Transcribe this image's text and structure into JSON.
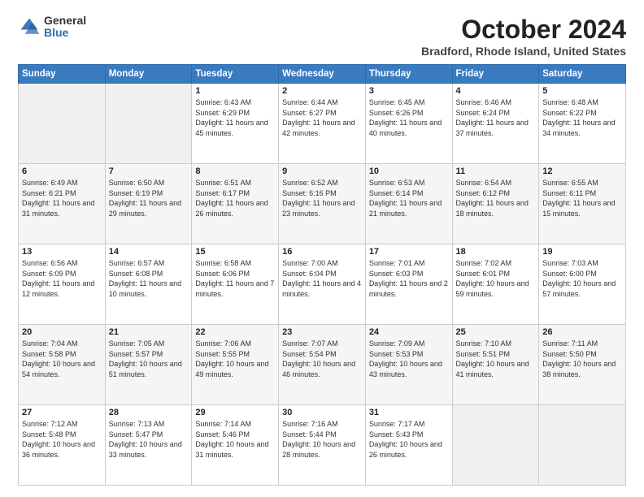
{
  "logo": {
    "general": "General",
    "blue": "Blue"
  },
  "title": "October 2024",
  "location": "Bradford, Rhode Island, United States",
  "days_of_week": [
    "Sunday",
    "Monday",
    "Tuesday",
    "Wednesday",
    "Thursday",
    "Friday",
    "Saturday"
  ],
  "weeks": [
    [
      {
        "day": "",
        "sunrise": "",
        "sunset": "",
        "daylight": ""
      },
      {
        "day": "",
        "sunrise": "",
        "sunset": "",
        "daylight": ""
      },
      {
        "day": "1",
        "sunrise": "Sunrise: 6:43 AM",
        "sunset": "Sunset: 6:29 PM",
        "daylight": "Daylight: 11 hours and 45 minutes."
      },
      {
        "day": "2",
        "sunrise": "Sunrise: 6:44 AM",
        "sunset": "Sunset: 6:27 PM",
        "daylight": "Daylight: 11 hours and 42 minutes."
      },
      {
        "day": "3",
        "sunrise": "Sunrise: 6:45 AM",
        "sunset": "Sunset: 6:26 PM",
        "daylight": "Daylight: 11 hours and 40 minutes."
      },
      {
        "day": "4",
        "sunrise": "Sunrise: 6:46 AM",
        "sunset": "Sunset: 6:24 PM",
        "daylight": "Daylight: 11 hours and 37 minutes."
      },
      {
        "day": "5",
        "sunrise": "Sunrise: 6:48 AM",
        "sunset": "Sunset: 6:22 PM",
        "daylight": "Daylight: 11 hours and 34 minutes."
      }
    ],
    [
      {
        "day": "6",
        "sunrise": "Sunrise: 6:49 AM",
        "sunset": "Sunset: 6:21 PM",
        "daylight": "Daylight: 11 hours and 31 minutes."
      },
      {
        "day": "7",
        "sunrise": "Sunrise: 6:50 AM",
        "sunset": "Sunset: 6:19 PM",
        "daylight": "Daylight: 11 hours and 29 minutes."
      },
      {
        "day": "8",
        "sunrise": "Sunrise: 6:51 AM",
        "sunset": "Sunset: 6:17 PM",
        "daylight": "Daylight: 11 hours and 26 minutes."
      },
      {
        "day": "9",
        "sunrise": "Sunrise: 6:52 AM",
        "sunset": "Sunset: 6:16 PM",
        "daylight": "Daylight: 11 hours and 23 minutes."
      },
      {
        "day": "10",
        "sunrise": "Sunrise: 6:53 AM",
        "sunset": "Sunset: 6:14 PM",
        "daylight": "Daylight: 11 hours and 21 minutes."
      },
      {
        "day": "11",
        "sunrise": "Sunrise: 6:54 AM",
        "sunset": "Sunset: 6:12 PM",
        "daylight": "Daylight: 11 hours and 18 minutes."
      },
      {
        "day": "12",
        "sunrise": "Sunrise: 6:55 AM",
        "sunset": "Sunset: 6:11 PM",
        "daylight": "Daylight: 11 hours and 15 minutes."
      }
    ],
    [
      {
        "day": "13",
        "sunrise": "Sunrise: 6:56 AM",
        "sunset": "Sunset: 6:09 PM",
        "daylight": "Daylight: 11 hours and 12 minutes."
      },
      {
        "day": "14",
        "sunrise": "Sunrise: 6:57 AM",
        "sunset": "Sunset: 6:08 PM",
        "daylight": "Daylight: 11 hours and 10 minutes."
      },
      {
        "day": "15",
        "sunrise": "Sunrise: 6:58 AM",
        "sunset": "Sunset: 6:06 PM",
        "daylight": "Daylight: 11 hours and 7 minutes."
      },
      {
        "day": "16",
        "sunrise": "Sunrise: 7:00 AM",
        "sunset": "Sunset: 6:04 PM",
        "daylight": "Daylight: 11 hours and 4 minutes."
      },
      {
        "day": "17",
        "sunrise": "Sunrise: 7:01 AM",
        "sunset": "Sunset: 6:03 PM",
        "daylight": "Daylight: 11 hours and 2 minutes."
      },
      {
        "day": "18",
        "sunrise": "Sunrise: 7:02 AM",
        "sunset": "Sunset: 6:01 PM",
        "daylight": "Daylight: 10 hours and 59 minutes."
      },
      {
        "day": "19",
        "sunrise": "Sunrise: 7:03 AM",
        "sunset": "Sunset: 6:00 PM",
        "daylight": "Daylight: 10 hours and 57 minutes."
      }
    ],
    [
      {
        "day": "20",
        "sunrise": "Sunrise: 7:04 AM",
        "sunset": "Sunset: 5:58 PM",
        "daylight": "Daylight: 10 hours and 54 minutes."
      },
      {
        "day": "21",
        "sunrise": "Sunrise: 7:05 AM",
        "sunset": "Sunset: 5:57 PM",
        "daylight": "Daylight: 10 hours and 51 minutes."
      },
      {
        "day": "22",
        "sunrise": "Sunrise: 7:06 AM",
        "sunset": "Sunset: 5:55 PM",
        "daylight": "Daylight: 10 hours and 49 minutes."
      },
      {
        "day": "23",
        "sunrise": "Sunrise: 7:07 AM",
        "sunset": "Sunset: 5:54 PM",
        "daylight": "Daylight: 10 hours and 46 minutes."
      },
      {
        "day": "24",
        "sunrise": "Sunrise: 7:09 AM",
        "sunset": "Sunset: 5:53 PM",
        "daylight": "Daylight: 10 hours and 43 minutes."
      },
      {
        "day": "25",
        "sunrise": "Sunrise: 7:10 AM",
        "sunset": "Sunset: 5:51 PM",
        "daylight": "Daylight: 10 hours and 41 minutes."
      },
      {
        "day": "26",
        "sunrise": "Sunrise: 7:11 AM",
        "sunset": "Sunset: 5:50 PM",
        "daylight": "Daylight: 10 hours and 38 minutes."
      }
    ],
    [
      {
        "day": "27",
        "sunrise": "Sunrise: 7:12 AM",
        "sunset": "Sunset: 5:48 PM",
        "daylight": "Daylight: 10 hours and 36 minutes."
      },
      {
        "day": "28",
        "sunrise": "Sunrise: 7:13 AM",
        "sunset": "Sunset: 5:47 PM",
        "daylight": "Daylight: 10 hours and 33 minutes."
      },
      {
        "day": "29",
        "sunrise": "Sunrise: 7:14 AM",
        "sunset": "Sunset: 5:46 PM",
        "daylight": "Daylight: 10 hours and 31 minutes."
      },
      {
        "day": "30",
        "sunrise": "Sunrise: 7:16 AM",
        "sunset": "Sunset: 5:44 PM",
        "daylight": "Daylight: 10 hours and 28 minutes."
      },
      {
        "day": "31",
        "sunrise": "Sunrise: 7:17 AM",
        "sunset": "Sunset: 5:43 PM",
        "daylight": "Daylight: 10 hours and 26 minutes."
      },
      {
        "day": "",
        "sunrise": "",
        "sunset": "",
        "daylight": ""
      },
      {
        "day": "",
        "sunrise": "",
        "sunset": "",
        "daylight": ""
      }
    ]
  ]
}
